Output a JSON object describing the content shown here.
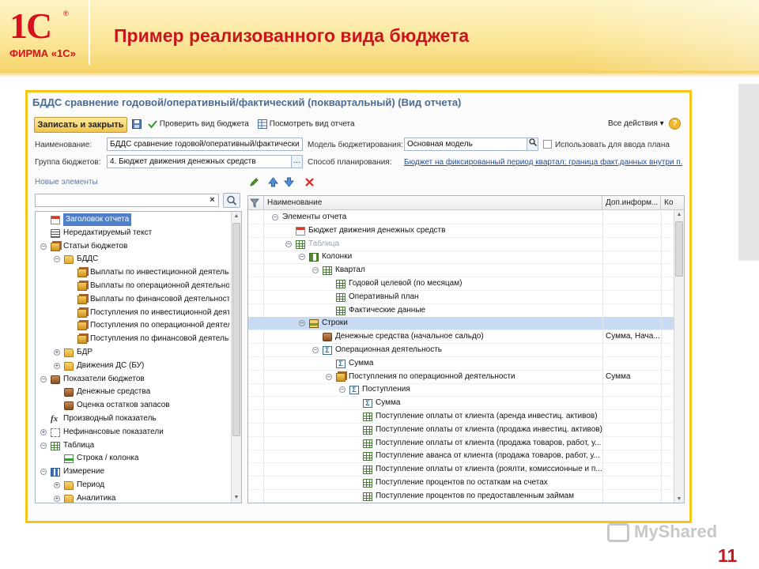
{
  "slide": {
    "title": "Пример реализованного вида бюджета",
    "logo_mark": "1С",
    "logo_reg": "®",
    "logo_text": "ФИРМА «1С»",
    "number": "11",
    "watermark": "MyShared"
  },
  "window": {
    "title": "БДДС сравнение годовой/оперативный/фактический (поквартальный) (Вид отчета)"
  },
  "toolbar": {
    "save_close": "Записать и закрыть",
    "check": "Проверить вид бюджета",
    "view": "Посмотреть вид отчета",
    "all_actions": "Все действия ▾",
    "help": "?"
  },
  "form": {
    "name_label": "Наименование:",
    "name_value": "БДДС сравнение годовой/оперативный/фактически",
    "model_label": "Модель бюджетирования:",
    "model_value": "Основная модель",
    "use_plan_label": "Использовать для ввода плана",
    "group_label": "Группа бюджетов:",
    "group_value": "4. Бюджет движения денежных средств",
    "planning_label": "Способ планирования:",
    "planning_link": "Бюджет на фиксированный период квартал; граница факт.данных внутри п...",
    "new_elements_label": "Новые элементы"
  },
  "left_tree": [
    {
      "label": "Заголовок отчета",
      "icon": "document-icon",
      "depth": 0,
      "exp": "",
      "selected": true
    },
    {
      "label": "Нередактируемый текст",
      "icon": "text-icon",
      "depth": 0,
      "exp": ""
    },
    {
      "label": "Статьи бюджетов",
      "icon": "folder-stack-icon",
      "depth": 0,
      "exp": "⊖"
    },
    {
      "label": "БДДС",
      "icon": "folder-icon",
      "depth": 1,
      "exp": "⊖"
    },
    {
      "label": "Выплаты по инвестиционной деятельности",
      "icon": "folder-stack-icon",
      "depth": 2,
      "exp": ""
    },
    {
      "label": "Выплаты по операционной деятельности",
      "icon": "folder-stack-icon",
      "depth": 2,
      "exp": ""
    },
    {
      "label": "Выплаты по финансовой деятельности",
      "icon": "folder-stack-icon",
      "depth": 2,
      "exp": ""
    },
    {
      "label": "Поступления по инвестиционной деятельности",
      "icon": "folder-stack-icon",
      "depth": 2,
      "exp": ""
    },
    {
      "label": "Поступления по операционной деятельности",
      "icon": "folder-stack-icon",
      "depth": 2,
      "exp": ""
    },
    {
      "label": "Поступления по финансовой деятельности",
      "icon": "folder-stack-icon",
      "depth": 2,
      "exp": ""
    },
    {
      "label": "БДР",
      "icon": "folder-icon",
      "depth": 1,
      "exp": "⊕"
    },
    {
      "label": "Движения ДС (БУ)",
      "icon": "folder-icon",
      "depth": 1,
      "exp": "⊕"
    },
    {
      "label": "Показатели бюджетов",
      "icon": "money-icon",
      "depth": 0,
      "exp": "⊖"
    },
    {
      "label": "Денежные средства",
      "icon": "money-icon",
      "depth": 1,
      "exp": ""
    },
    {
      "label": "Оценка остатков запасов",
      "icon": "money-icon",
      "depth": 1,
      "exp": ""
    },
    {
      "label": "Производный показатель",
      "icon": "fx-icon",
      "depth": 0,
      "exp": ""
    },
    {
      "label": "Нефинансовые показатели",
      "icon": "nonfinancial-icon",
      "depth": 0,
      "exp": "⊕"
    },
    {
      "label": "Таблица",
      "icon": "table-icon",
      "depth": 0,
      "exp": "⊖"
    },
    {
      "label": "Строка / колонка",
      "icon": "line-icon",
      "depth": 1,
      "exp": ""
    },
    {
      "label": "Измерение",
      "icon": "dimension-icon",
      "depth": 0,
      "exp": "⊖"
    },
    {
      "label": "Период",
      "icon": "folder-icon",
      "depth": 1,
      "exp": "⊕"
    },
    {
      "label": "Аналитика",
      "icon": "folder-icon",
      "depth": 1,
      "exp": "⊕"
    }
  ],
  "grid": {
    "headers": [
      "Наименование",
      "Доп.информ...",
      "Ко"
    ],
    "rows": [
      {
        "label": "Элементы отчета",
        "icon": "",
        "depth": 0,
        "exp": "⊖",
        "extra": ""
      },
      {
        "label": "Бюджет движения денежных средств",
        "icon": "document-icon",
        "depth": 1,
        "exp": "",
        "extra": ""
      },
      {
        "label": "Таблица",
        "icon": "table-icon",
        "depth": 1,
        "exp": "⊖",
        "extra": "",
        "muted": true
      },
      {
        "label": "Колонки",
        "icon": "columns-icon",
        "depth": 2,
        "exp": "⊖",
        "extra": ""
      },
      {
        "label": "Квартал",
        "icon": "table-icon",
        "depth": 3,
        "exp": "⊖",
        "extra": ""
      },
      {
        "label": "Годовой целевой (по месяцам)",
        "icon": "table-icon",
        "depth": 4,
        "exp": "",
        "extra": ""
      },
      {
        "label": "Оперативный план",
        "icon": "table-icon",
        "depth": 4,
        "exp": "",
        "extra": ""
      },
      {
        "label": "Фактические данные",
        "icon": "table-icon",
        "depth": 4,
        "exp": "",
        "extra": ""
      },
      {
        "label": "Строки",
        "icon": "rows-icon",
        "depth": 2,
        "exp": "⊖",
        "extra": "",
        "selected": true
      },
      {
        "label": "Денежные средства (начальное сальдо)",
        "icon": "money-icon",
        "depth": 3,
        "exp": "",
        "extra": "Сумма, Нача..."
      },
      {
        "label": "Операционная деятельность",
        "icon": "sum-icon",
        "depth": 3,
        "exp": "⊖",
        "extra": ""
      },
      {
        "label": "Сумма",
        "icon": "sum-icon",
        "depth": 4,
        "exp": "",
        "extra": ""
      },
      {
        "label": "Поступления по операционной деятельности",
        "icon": "folder-stack-icon",
        "depth": 4,
        "exp": "⊖",
        "extra": "Сумма"
      },
      {
        "label": "Поступления",
        "icon": "sum-icon",
        "depth": 5,
        "exp": "⊖",
        "extra": ""
      },
      {
        "label": "Сумма",
        "icon": "sum-icon",
        "depth": 6,
        "exp": "",
        "extra": ""
      },
      {
        "label": "Поступление оплаты от клиента (аренда инвестиц. активов)",
        "icon": "table-icon",
        "depth": 6,
        "exp": "",
        "extra": ""
      },
      {
        "label": "Поступление оплаты от клиента (продажа инвестиц. активов)",
        "icon": "table-icon",
        "depth": 6,
        "exp": "",
        "extra": ""
      },
      {
        "label": "Поступление оплаты от клиента (продажа товаров, работ, у...",
        "icon": "table-icon",
        "depth": 6,
        "exp": "",
        "extra": ""
      },
      {
        "label": "Поступление аванса от клиента (продажа товаров, работ, у...",
        "icon": "table-icon",
        "depth": 6,
        "exp": "",
        "extra": ""
      },
      {
        "label": "Поступление оплаты от клиента (роялти, комиссионные и п...",
        "icon": "table-icon",
        "depth": 6,
        "exp": "",
        "extra": ""
      },
      {
        "label": "Поступление процентов по остаткам на счетах",
        "icon": "table-icon",
        "depth": 6,
        "exp": "",
        "extra": ""
      },
      {
        "label": "Поступление процентов по предоставленным займам",
        "icon": "table-icon",
        "depth": 6,
        "exp": "",
        "extra": ""
      }
    ]
  },
  "colors": {
    "accent_red": "#c8161d",
    "frame_yellow": "#f5c518",
    "selection_blue": "#4f7fc7",
    "title_blue": "#4a6c94"
  }
}
